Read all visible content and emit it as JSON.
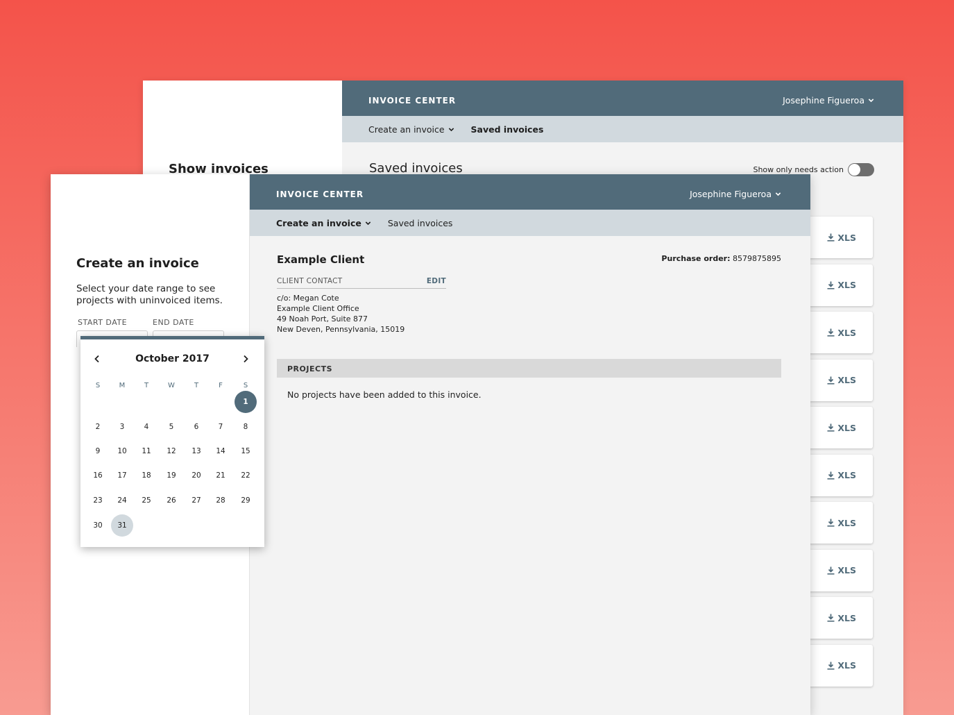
{
  "back_window": {
    "left_panel_title": "Show invoices",
    "app_title": "INVOICE CENTER",
    "user_name": "Josephine Figueroa",
    "nav": {
      "create": "Create an invoice",
      "saved": "Saved invoices"
    },
    "main_title": "Saved invoices",
    "toggle_label": "Show only needs action",
    "xls_label": "XLS",
    "xls_count": 10
  },
  "front_window": {
    "app_title": "INVOICE CENTER",
    "user_name": "Josephine Figueroa",
    "nav": {
      "create": "Create an invoice",
      "saved": "Saved invoices"
    },
    "left_panel": {
      "title": "Create an invoice",
      "description": "Select your date range to see projects with uninvoiced items.",
      "start_label": "START DATE",
      "end_label": "END DATE"
    },
    "client": {
      "name": "Example Client",
      "po_label": "Purchase order:",
      "po_value": "8579875895",
      "contact_label": "CLIENT CONTACT",
      "edit_label": "EDIT",
      "address": [
        "c/o: Megan Cote",
        "Example Client Office",
        "49 Noah Port, Suite 877",
        "New Deven, Pennsylvania, 15019"
      ]
    },
    "projects_label": "PROJECTS",
    "no_projects": "No projects have been added to this invoice."
  },
  "calendar": {
    "month": "October 2017",
    "weekdays": [
      "S",
      "M",
      "T",
      "W",
      "T",
      "F",
      "S"
    ],
    "first_weekday": 6,
    "days_in_month": 31,
    "selected_start": 1,
    "selected_end": 31
  },
  "colors": {
    "header": "#516b7a",
    "subnav": "#d1d9de",
    "background_top": "#f4534a",
    "background_bottom": "#f89b91"
  }
}
